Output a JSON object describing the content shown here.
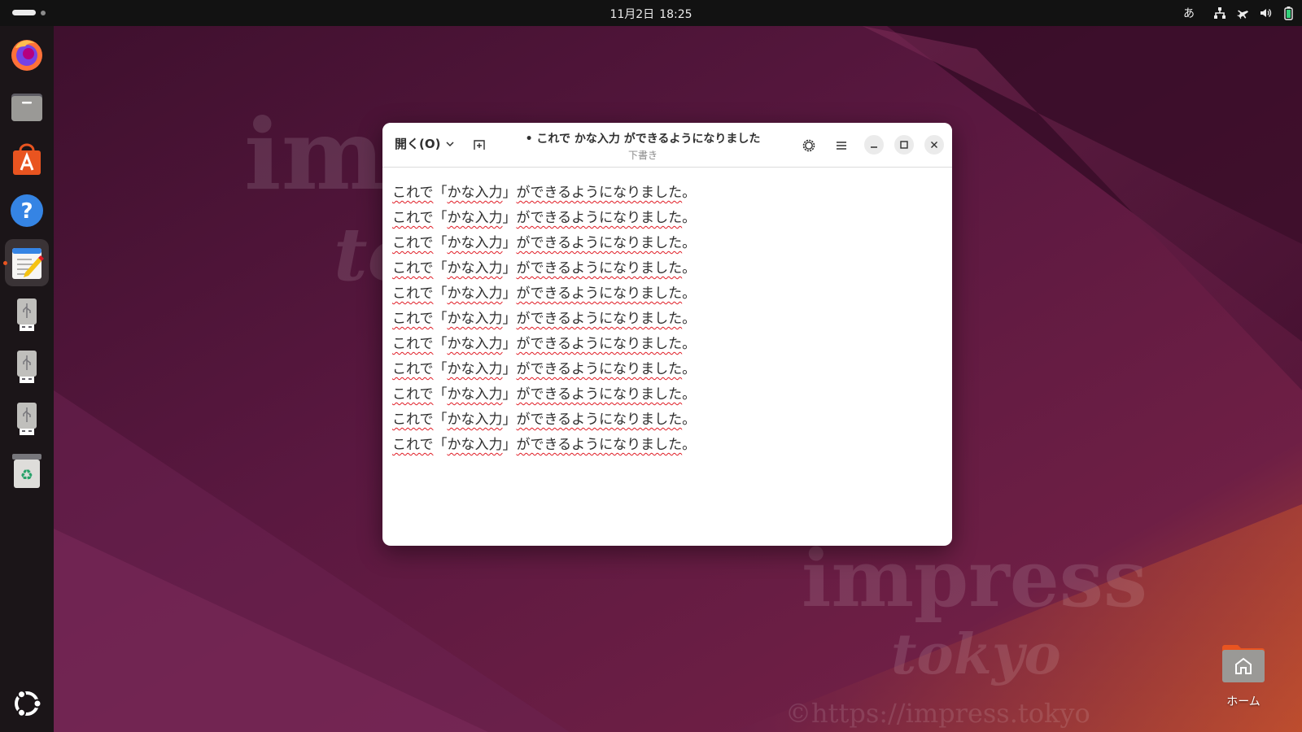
{
  "topbar": {
    "date": "11月2日",
    "time": "18:25",
    "input_method": "あ"
  },
  "dock": {
    "items": [
      {
        "name": "firefox-launcher"
      },
      {
        "name": "files-launcher"
      },
      {
        "name": "app-center-launcher"
      },
      {
        "name": "help-launcher"
      },
      {
        "name": "text-editor-launcher",
        "active": true
      },
      {
        "name": "usb-drive-1"
      },
      {
        "name": "usb-drive-2"
      },
      {
        "name": "usb-drive-3"
      },
      {
        "name": "trash-launcher"
      }
    ]
  },
  "window": {
    "open_label": "開く(O)",
    "title": "• これで かな入力 ができるようになりました",
    "subtitle": "下書き",
    "lines": [
      "これで「かな入力」ができるようになりました。",
      "これで「かな入力」ができるようになりました。",
      "これで「かな入力」ができるようになりました。",
      "これで「かな入力」ができるようになりました。",
      "これで「かな入力」ができるようになりました。",
      "これで「かな入力」ができるようになりました。",
      "これで「かな入力」ができるようになりました。",
      "これで「かな入力」ができるようになりました。",
      "これで「かな入力」ができるようになりました。",
      "これで「かな入力」ができるようになりました。",
      "これで「かな入力」ができるようになりました。"
    ],
    "line_parts": {
      "a": "これで",
      "b": "「",
      "c": "かな入力",
      "d": "」",
      "e": "ができるようになりました",
      "f": "。"
    }
  },
  "desktop": {
    "home_label": "ホーム",
    "watermark": {
      "word1": "impress",
      "word2": "tokyo",
      "url": "©https://impress.tokyo"
    }
  },
  "colors": {
    "accent": "#e95420",
    "spell_error": "#e01b24",
    "topbar_bg": "#121212",
    "dock_bg": "#1b1518"
  }
}
